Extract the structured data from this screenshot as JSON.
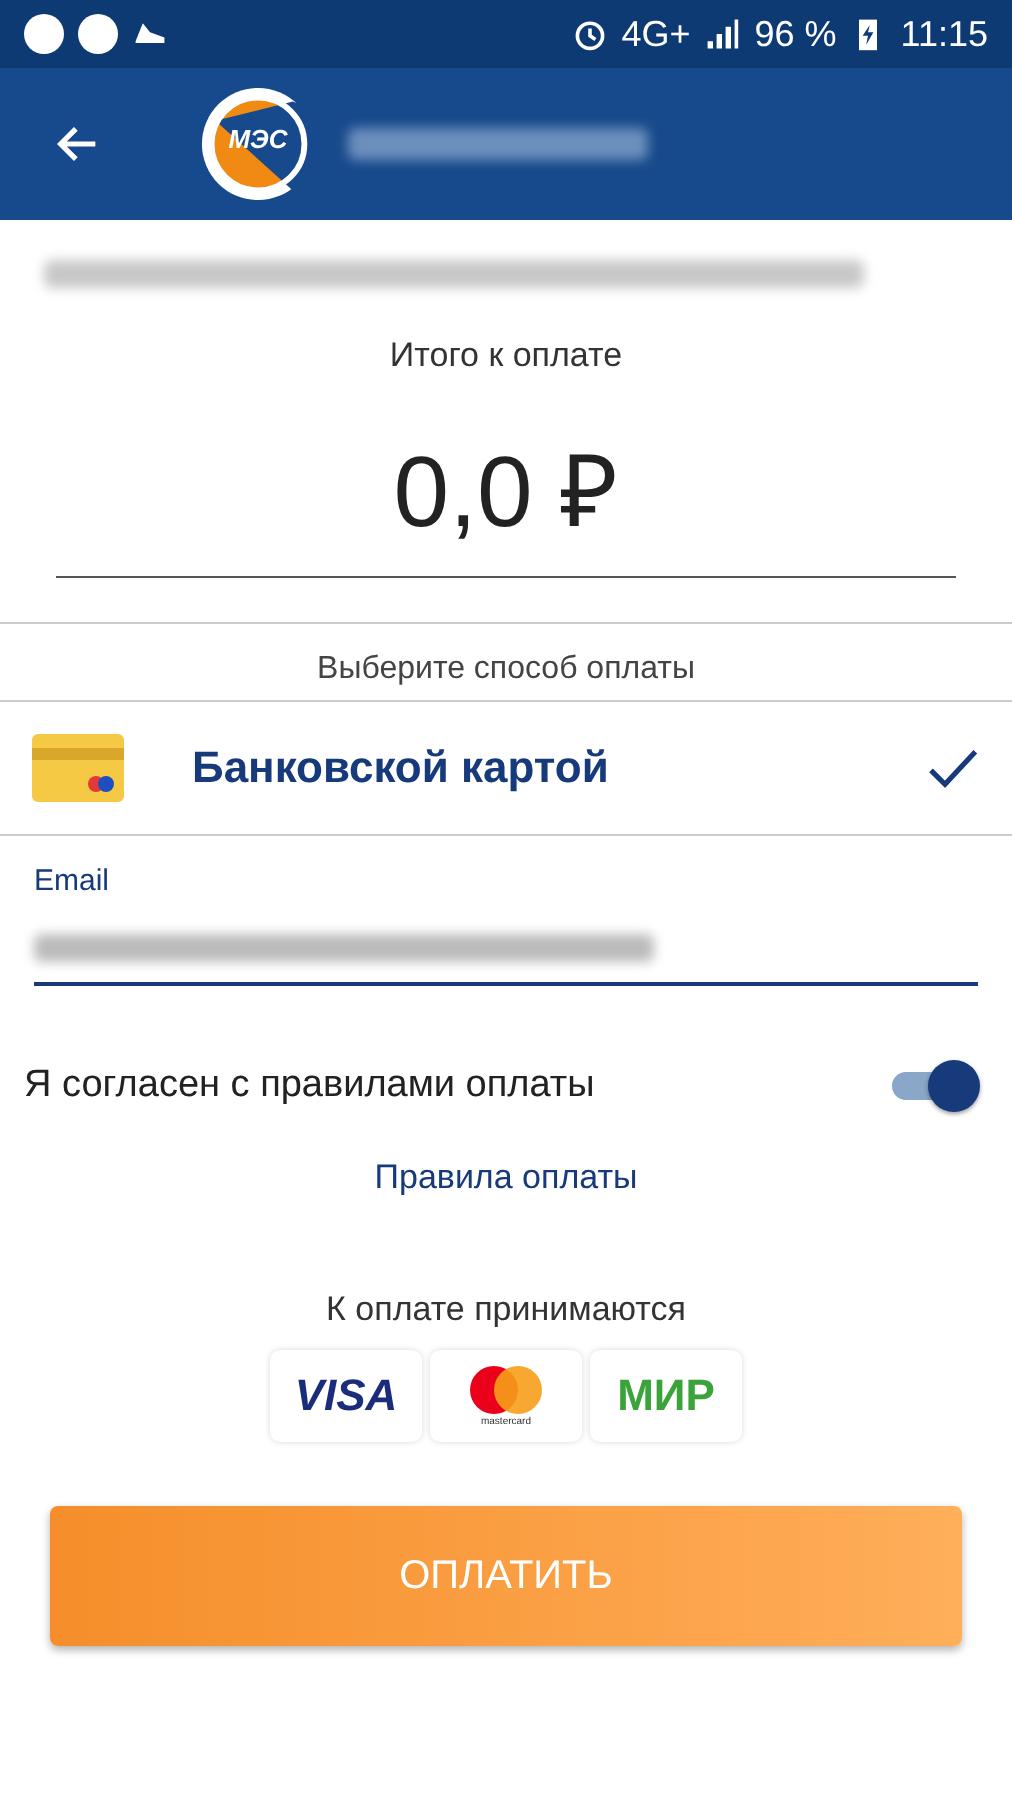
{
  "status_bar": {
    "network": "4G+",
    "battery": "96 %",
    "time": "11:15"
  },
  "header": {
    "logo_text": "МЭС"
  },
  "total": {
    "label": "Итого к оплате",
    "amount": "0,0 ₽"
  },
  "method_prompt": "Выберите способ оплаты",
  "methods": [
    {
      "label": "Банковской картой",
      "selected": true
    }
  ],
  "email": {
    "label": "Email"
  },
  "agree": {
    "label": "Я согласен с правилами оплаты",
    "on": true
  },
  "rules_link": "Правила оплаты",
  "accepted": {
    "label": "К оплате принимаются",
    "cards": [
      {
        "kind": "visa",
        "text": "VISA"
      },
      {
        "kind": "mastercard",
        "text": "mastercard"
      },
      {
        "kind": "mir",
        "text": "МИР"
      }
    ]
  },
  "pay_button": "ОПЛАТИТЬ"
}
